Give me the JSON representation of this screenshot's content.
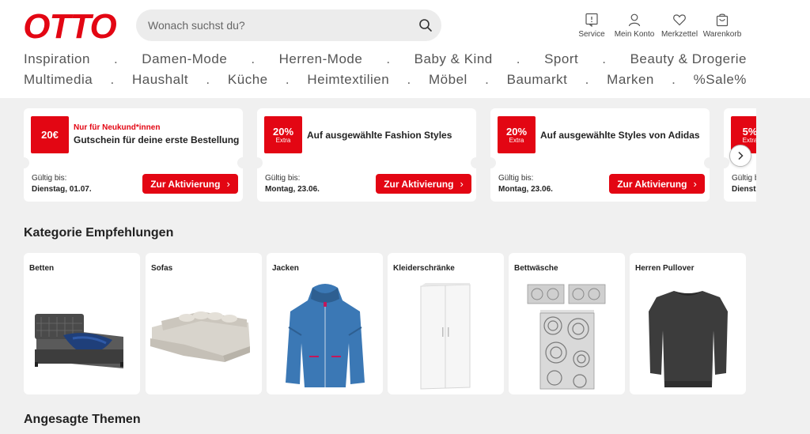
{
  "brand": {
    "logo_text": "OTTO",
    "accent": "#e30613"
  },
  "search": {
    "placeholder": "Wonach suchst du?",
    "icon": "search-icon"
  },
  "service_nav": [
    {
      "label": "Service",
      "icon": "service-icon"
    },
    {
      "label": "Mein Konto",
      "icon": "user-icon"
    },
    {
      "label": "Merkzettel",
      "icon": "heart-icon"
    },
    {
      "label": "Warenkorb",
      "icon": "bag-icon"
    }
  ],
  "nav": {
    "row1": [
      "Inspiration",
      "Damen-Mode",
      "Herren-Mode",
      "Baby & Kind",
      "Sport",
      "Beauty & Drogerie"
    ],
    "row2": [
      "Multimedia",
      "Haushalt",
      "Küche",
      "Heimtextilien",
      "Möbel",
      "Baumarkt",
      "Marken",
      "%Sale%"
    ],
    "separator": "."
  },
  "coupons": [
    {
      "badge_value": "20€",
      "badge_sub": "",
      "eyebrow": "Nur für Neukund*innen",
      "title": "Gutschein für deine erste Bestellung",
      "valid_label": "Gültig bis:",
      "valid_date": "Dienstag, 01.07.",
      "button": "Zur Aktivierung"
    },
    {
      "badge_value": "20%",
      "badge_sub": "Extra",
      "eyebrow": "",
      "title": "Auf ausgewählte Fashion Styles",
      "valid_label": "Gültig bis:",
      "valid_date": "Montag, 23.06.",
      "button": "Zur Aktivierung"
    },
    {
      "badge_value": "20%",
      "badge_sub": "Extra",
      "eyebrow": "",
      "title": "Auf ausgewählte Styles von Adidas",
      "valid_label": "Gültig bis:",
      "valid_date": "Montag, 23.06.",
      "button": "Zur Aktivierung"
    },
    {
      "badge_value": "5%",
      "badge_sub": "Extra",
      "eyebrow": "",
      "title": "",
      "valid_label": "Gültig b",
      "valid_date": "Dienst",
      "button": ""
    }
  ],
  "sections": {
    "categories_title": "Kategorie Empfehlungen",
    "trending_title": "Angesagte Themen"
  },
  "categories": [
    {
      "label": "Betten",
      "icon": "boxspring-bed-image"
    },
    {
      "label": "Sofas",
      "icon": "sofa-image"
    },
    {
      "label": "Jacken",
      "icon": "jacket-image"
    },
    {
      "label": "Kleiderschränke",
      "icon": "wardrobe-image"
    },
    {
      "label": "Bettwäsche",
      "icon": "bedding-image"
    },
    {
      "label": "Herren Pullover",
      "icon": "sweater-image"
    }
  ]
}
